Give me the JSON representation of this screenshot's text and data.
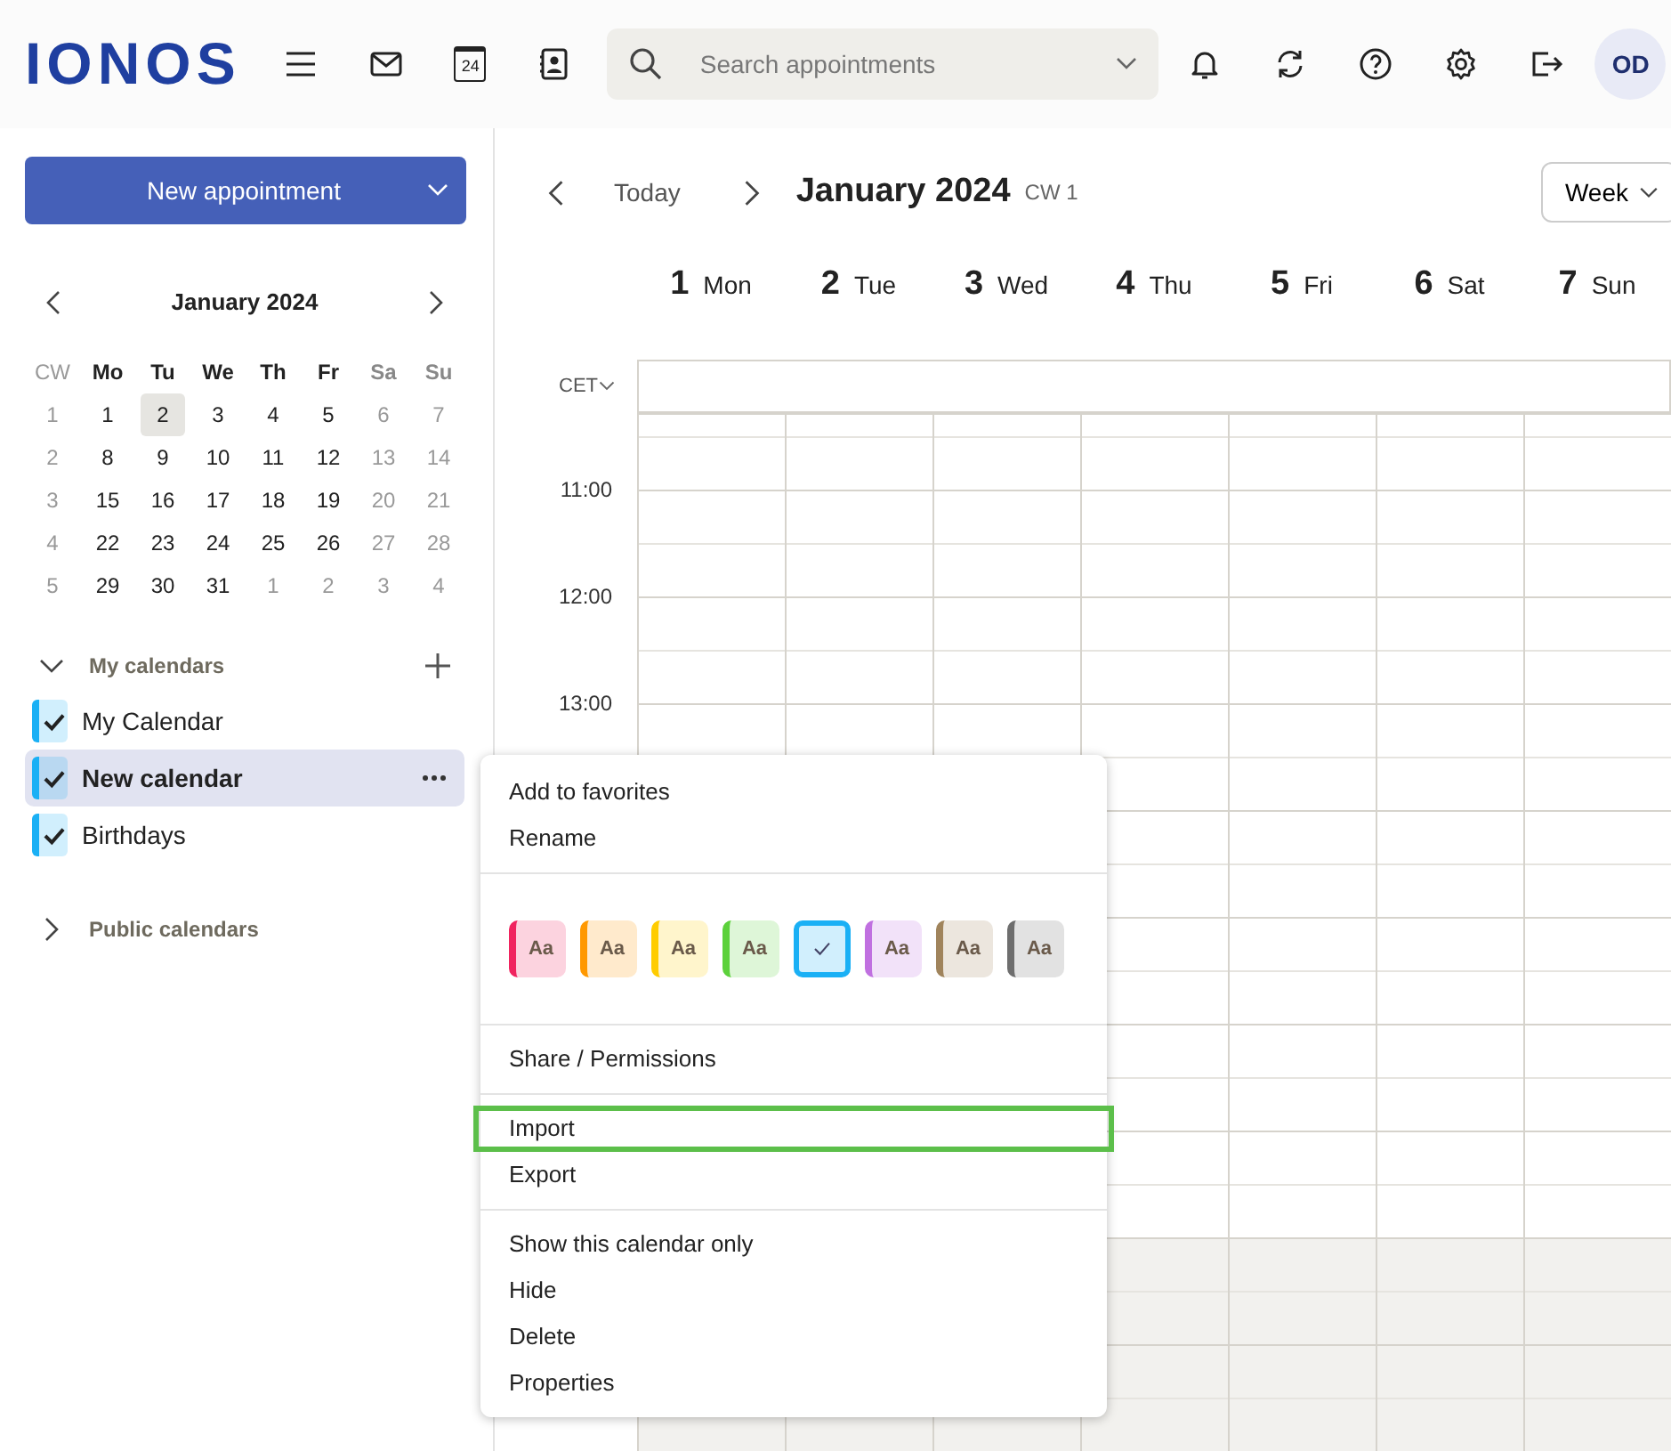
{
  "header": {
    "logo": "IONOS",
    "calendar_icon_day": "24",
    "search": {
      "placeholder": "Search appointments"
    },
    "avatar": "OD"
  },
  "sidebar": {
    "new_button": "New appointment",
    "mini_calendar": {
      "title": "January 2024",
      "weekday_header": [
        "CW",
        "Mo",
        "Tu",
        "We",
        "Th",
        "Fr",
        "Sa",
        "Su"
      ],
      "weeks": [
        {
          "cw": "1",
          "days": [
            {
              "label": "1",
              "muted": false,
              "selected": false
            },
            {
              "label": "2",
              "muted": false,
              "selected": true
            },
            {
              "label": "3",
              "muted": false,
              "selected": false
            },
            {
              "label": "4",
              "muted": false,
              "selected": false
            },
            {
              "label": "5",
              "muted": false,
              "selected": false
            },
            {
              "label": "6",
              "muted": true,
              "selected": false
            },
            {
              "label": "7",
              "muted": true,
              "selected": false
            }
          ]
        },
        {
          "cw": "2",
          "days": [
            {
              "label": "8",
              "muted": false,
              "selected": false
            },
            {
              "label": "9",
              "muted": false,
              "selected": false
            },
            {
              "label": "10",
              "muted": false,
              "selected": false
            },
            {
              "label": "11",
              "muted": false,
              "selected": false
            },
            {
              "label": "12",
              "muted": false,
              "selected": false
            },
            {
              "label": "13",
              "muted": true,
              "selected": false
            },
            {
              "label": "14",
              "muted": true,
              "selected": false
            }
          ]
        },
        {
          "cw": "3",
          "days": [
            {
              "label": "15",
              "muted": false,
              "selected": false
            },
            {
              "label": "16",
              "muted": false,
              "selected": false
            },
            {
              "label": "17",
              "muted": false,
              "selected": false
            },
            {
              "label": "18",
              "muted": false,
              "selected": false
            },
            {
              "label": "19",
              "muted": false,
              "selected": false
            },
            {
              "label": "20",
              "muted": true,
              "selected": false
            },
            {
              "label": "21",
              "muted": true,
              "selected": false
            }
          ]
        },
        {
          "cw": "4",
          "days": [
            {
              "label": "22",
              "muted": false,
              "selected": false
            },
            {
              "label": "23",
              "muted": false,
              "selected": false
            },
            {
              "label": "24",
              "muted": false,
              "selected": false
            },
            {
              "label": "25",
              "muted": false,
              "selected": false
            },
            {
              "label": "26",
              "muted": false,
              "selected": false
            },
            {
              "label": "27",
              "muted": true,
              "selected": false
            },
            {
              "label": "28",
              "muted": true,
              "selected": false
            }
          ]
        },
        {
          "cw": "5",
          "days": [
            {
              "label": "29",
              "muted": false,
              "selected": false
            },
            {
              "label": "30",
              "muted": false,
              "selected": false
            },
            {
              "label": "31",
              "muted": false,
              "selected": false
            },
            {
              "label": "1",
              "muted": true,
              "selected": false
            },
            {
              "label": "2",
              "muted": true,
              "selected": false
            },
            {
              "label": "3",
              "muted": true,
              "selected": false
            },
            {
              "label": "4",
              "muted": true,
              "selected": false
            }
          ]
        }
      ]
    },
    "my_calendars": {
      "title": "My calendars",
      "expanded": true,
      "items": [
        {
          "name": "My Calendar",
          "checked": true,
          "selected": false,
          "color": "#1ab0f5"
        },
        {
          "name": "New calendar",
          "checked": true,
          "selected": true,
          "color": "#1ab0f5"
        },
        {
          "name": "Birthdays",
          "checked": true,
          "selected": false,
          "color": "#1ab0f5"
        }
      ]
    },
    "public_calendars": {
      "title": "Public calendars",
      "expanded": false
    }
  },
  "toolbar": {
    "today": "Today",
    "title": "January 2024",
    "week_label": "CW 1",
    "view": "Week"
  },
  "days": [
    {
      "number": "1",
      "name": "Mon"
    },
    {
      "number": "2",
      "name": "Tue"
    },
    {
      "number": "3",
      "name": "Wed"
    },
    {
      "number": "4",
      "name": "Thu"
    },
    {
      "number": "5",
      "name": "Fri"
    },
    {
      "number": "6",
      "name": "Sat"
    },
    {
      "number": "7",
      "name": "Sun"
    }
  ],
  "timezone": "CET",
  "hours": [
    {
      "label": "11:00",
      "off_hours": false
    },
    {
      "label": "12:00",
      "off_hours": false
    },
    {
      "label": "13:00",
      "off_hours": false
    },
    {
      "off_hours": false
    },
    {
      "off_hours": false
    },
    {
      "off_hours": false
    },
    {
      "off_hours": false
    },
    {
      "off_hours": true
    },
    {
      "off_hours": true
    }
  ],
  "context_menu": {
    "sections": [
      {
        "kind": "items",
        "items": [
          {
            "label": "Add to favorites",
            "highlighted": false
          },
          {
            "label": "Rename",
            "highlighted": false
          }
        ]
      },
      {
        "kind": "colors",
        "swatches": [
          {
            "label": "Aa",
            "color": "#f0245f",
            "selected": false
          },
          {
            "label": "Aa",
            "color": "#ff9800",
            "selected": false
          },
          {
            "label": "Aa",
            "color": "#ffcc00",
            "selected": false
          },
          {
            "label": "Aa",
            "color": "#5cd13b",
            "selected": false
          },
          {
            "color": "#1ab0f5",
            "selected": true
          },
          {
            "label": "Aa",
            "color": "#c070e0",
            "selected": false
          },
          {
            "label": "Aa",
            "color": "#a0845c",
            "selected": false
          },
          {
            "label": "Aa",
            "color": "#6e6e6e",
            "selected": false
          }
        ]
      },
      {
        "kind": "items",
        "items": [
          {
            "label": "Share / Permissions",
            "highlighted": false
          }
        ]
      },
      {
        "kind": "items",
        "items": [
          {
            "label": "Import",
            "highlighted": true
          },
          {
            "label": "Export",
            "highlighted": false
          }
        ]
      },
      {
        "kind": "items",
        "items": [
          {
            "label": "Show this calendar only",
            "highlighted": false
          },
          {
            "label": "Hide",
            "highlighted": false
          },
          {
            "label": "Delete",
            "highlighted": false
          },
          {
            "label": "Properties",
            "highlighted": false
          }
        ]
      }
    ]
  }
}
